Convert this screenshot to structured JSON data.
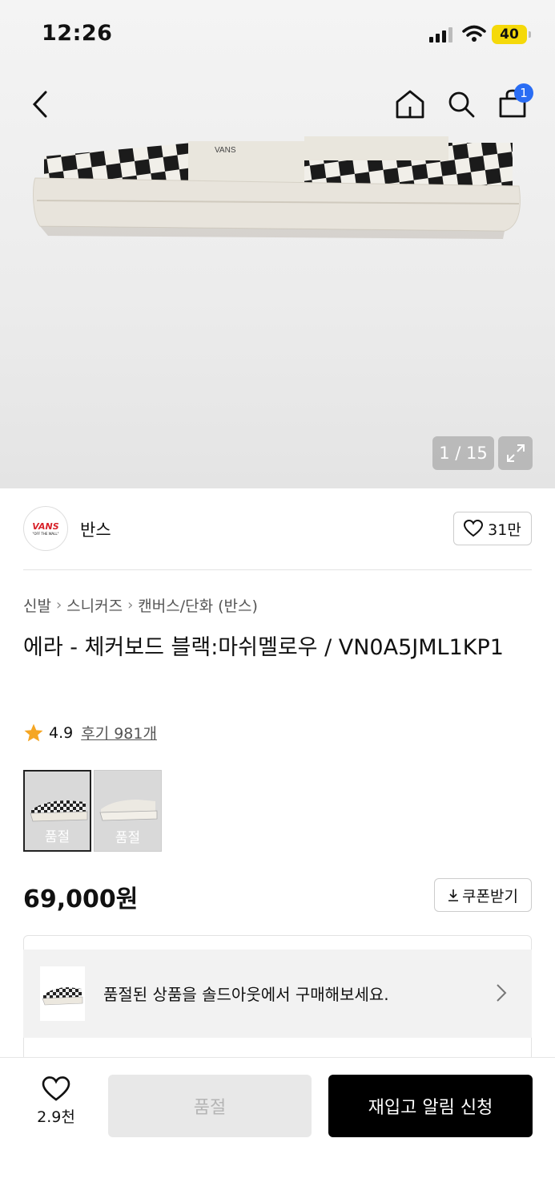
{
  "status_bar": {
    "time": "12:26",
    "battery": "40"
  },
  "nav": {
    "cart_count": "1"
  },
  "gallery": {
    "counter": "1 / 15"
  },
  "brand": {
    "logo_text": "VANS",
    "logo_sub": "\"OFF THE WALL\"",
    "name": "반스",
    "likes": "31만"
  },
  "breadcrumb": [
    "신발",
    "스니커즈",
    "캔버스/단화 (반스)"
  ],
  "product": {
    "title": "에라 - 체커보드 블랙:마쉬멜로우 / VN0A5JML1KP1",
    "rating": "4.9",
    "reviews": "후기 981개",
    "price": "69,000원"
  },
  "options": [
    {
      "label": "품절",
      "selected": true
    },
    {
      "label": "품절",
      "selected": false
    }
  ],
  "coupon": {
    "label": "쿠폰받기"
  },
  "banner": {
    "text": "품절된 상품을 솔드아웃에서 구매해보세요."
  },
  "bottom_bar": {
    "wish_count": "2.9천",
    "soldout_label": "품절",
    "restock_label": "재입고 알림 신청"
  },
  "colors": {
    "accent_blue": "#2a6df4",
    "star": "#f5a623",
    "battery": "#f5d90a"
  }
}
